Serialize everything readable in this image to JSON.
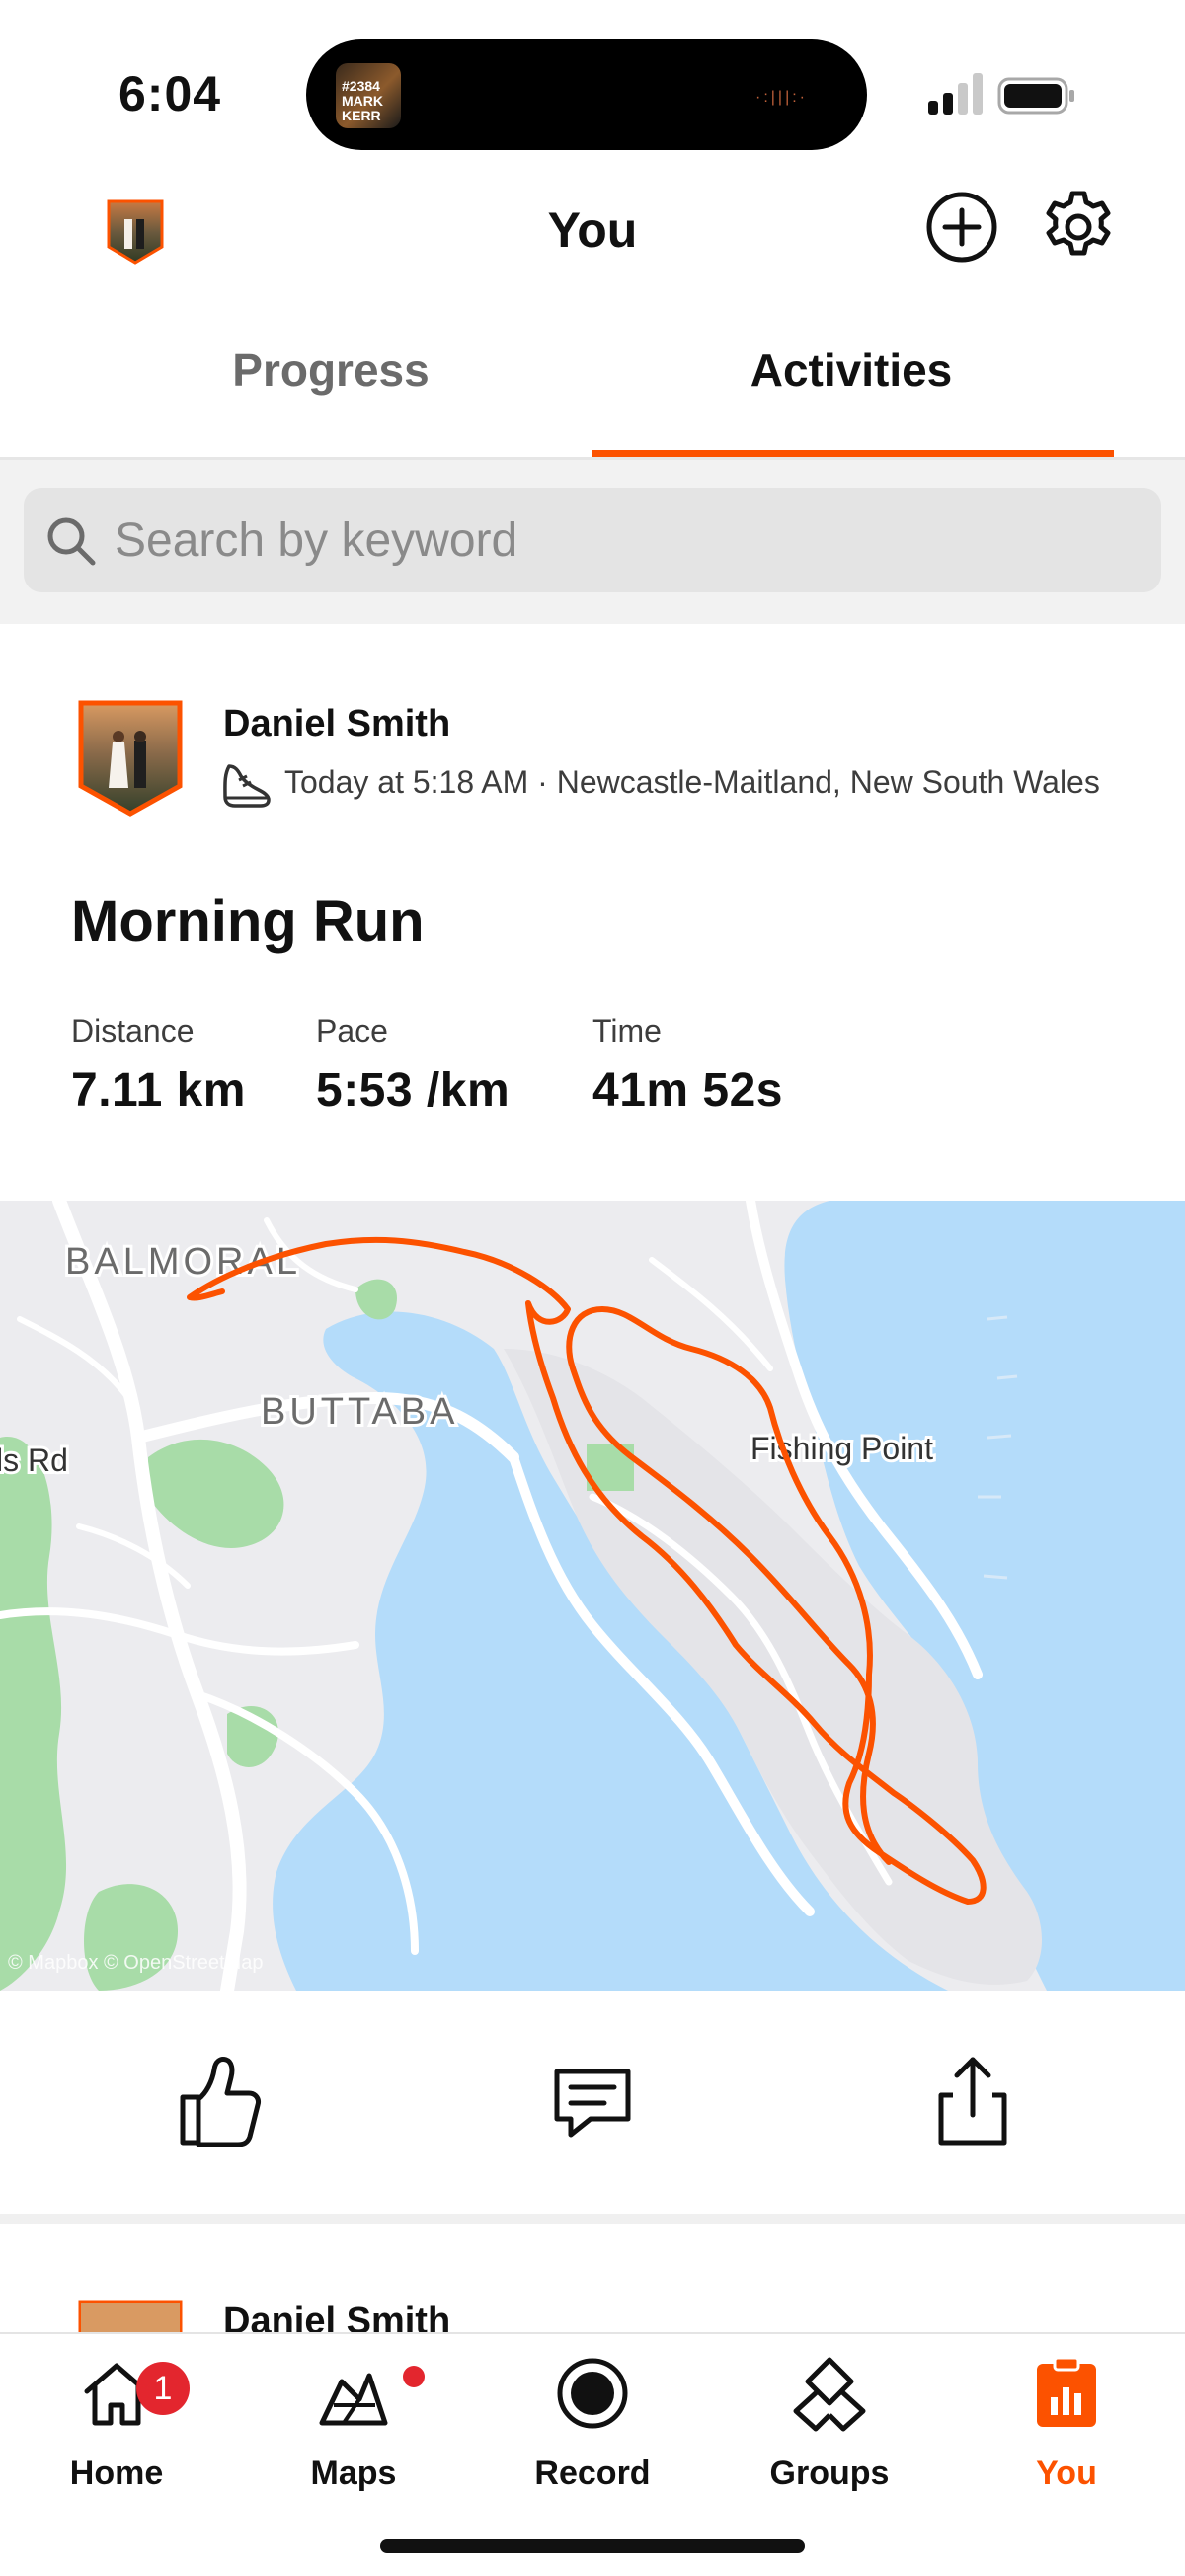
{
  "status_bar": {
    "time": "6:04",
    "now_playing_text": "#2384 MARK KERR",
    "now_playing_waveform": "·:|||:·"
  },
  "header": {
    "title": "You",
    "avatar_icon": "profile-photo",
    "add_icon": "plus-circle-icon",
    "settings_icon": "gear-icon"
  },
  "tabs": [
    {
      "label": "Progress",
      "active": false
    },
    {
      "label": "Activities",
      "active": true
    }
  ],
  "search": {
    "placeholder": "Search by keyword",
    "value": ""
  },
  "activity": {
    "athlete": "Daniel Smith",
    "meta": "Today at 5:18 AM · Newcastle-Maitland, New South Wales",
    "sport_icon": "running-shoe-icon",
    "title": "Morning Run",
    "stats": [
      {
        "label": "Distance",
        "value": "7.11 km"
      },
      {
        "label": "Pace",
        "value": "5:53 /km"
      },
      {
        "label": "Time",
        "value": "41m 52s"
      }
    ],
    "map": {
      "labels": {
        "balmoral": "BALMORAL",
        "buttaba": "BUTTABA",
        "road": "ls Rd",
        "fishing_point": "Fishing Point",
        "attribution": "© Mapbox © OpenStreetMap"
      },
      "route_color": "#fc5200",
      "water_color": "#b4dcfa",
      "park_color": "#a8dca8"
    },
    "actions": {
      "like_icon": "thumbs-up-icon",
      "comment_icon": "comment-icon",
      "share_icon": "share-icon"
    }
  },
  "next_activity": {
    "athlete": "Daniel Smith"
  },
  "bottom_nav": [
    {
      "label": "Home",
      "icon": "home-icon",
      "badge": "1"
    },
    {
      "label": "Maps",
      "icon": "maps-icon",
      "dot": true
    },
    {
      "label": "Record",
      "icon": "record-icon"
    },
    {
      "label": "Groups",
      "icon": "groups-icon"
    },
    {
      "label": "You",
      "icon": "you-icon",
      "active": true
    }
  ],
  "colors": {
    "accent": "#fc5200",
    "badge": "#e3262e"
  }
}
